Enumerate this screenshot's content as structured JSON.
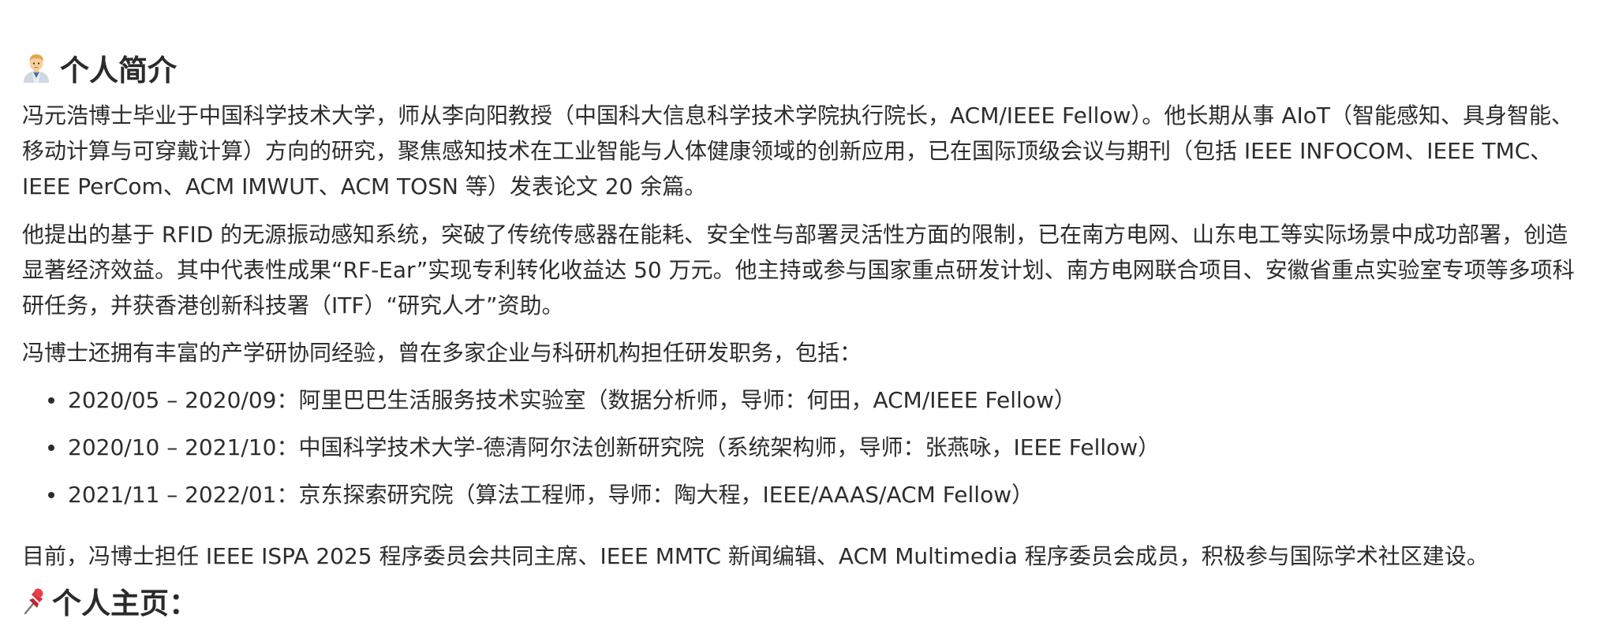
{
  "intro": {
    "heading_icon": "man-technologist-icon",
    "heading": "个人简介",
    "paragraphs": [
      "冯元浩博士毕业于中国科学技术大学，师从李向阳教授（中国科大信息科学技术学院执行院长，ACM/IEEE Fellow）。他长期从事 AIoT（智能感知、具身智能、移动计算与可穿戴计算）方向的研究，聚焦感知技术在工业智能与人体健康领域的创新应用，已在国际顶级会议与期刊（包括 IEEE INFOCOM、IEEE TMC、IEEE PerCom、ACM IMWUT、ACM TOSN 等）发表论文 20 余篇。",
      "他提出的基于 RFID 的无源振动感知系统，突破了传统传感器在能耗、安全性与部署灵活性方面的限制，已在南方电网、山东电工等实际场景中成功部署，创造显著经济效益。其中代表性成果“RF-Ear”实现专利转化收益达 50 万元。他主持或参与国家重点研发计划、南方电网联合项目、安徽省重点实验室专项等多项科研任务，并获香港创新科技署（ITF）“研究人才”资助。",
      "冯博士还拥有丰富的产学研协同经验，曾在多家企业与科研机构担任研发职务，包括："
    ],
    "experience": [
      "2020/05 – 2020/09：阿里巴巴生活服务技术实验室（数据分析师，导师：何田，ACM/IEEE Fellow）",
      "2020/10 – 2021/10：中国科学技术大学-德清阿尔法创新研究院（系统架构师，导师：张燕咏，IEEE Fellow）",
      "2021/11 – 2022/01：京东探索研究院（算法工程师，导师：陶大程，IEEE/AAAS/ACM Fellow）"
    ],
    "closing": "目前，冯博士担任 IEEE ISPA 2025 程序委员会共同主席、IEEE MMTC 新闻编辑、ACM Multimedia 程序委员会成员，积极参与国际学术社区建设。"
  },
  "homepage": {
    "heading_icon": "pushpin-icon",
    "heading": "个人主页："
  }
}
